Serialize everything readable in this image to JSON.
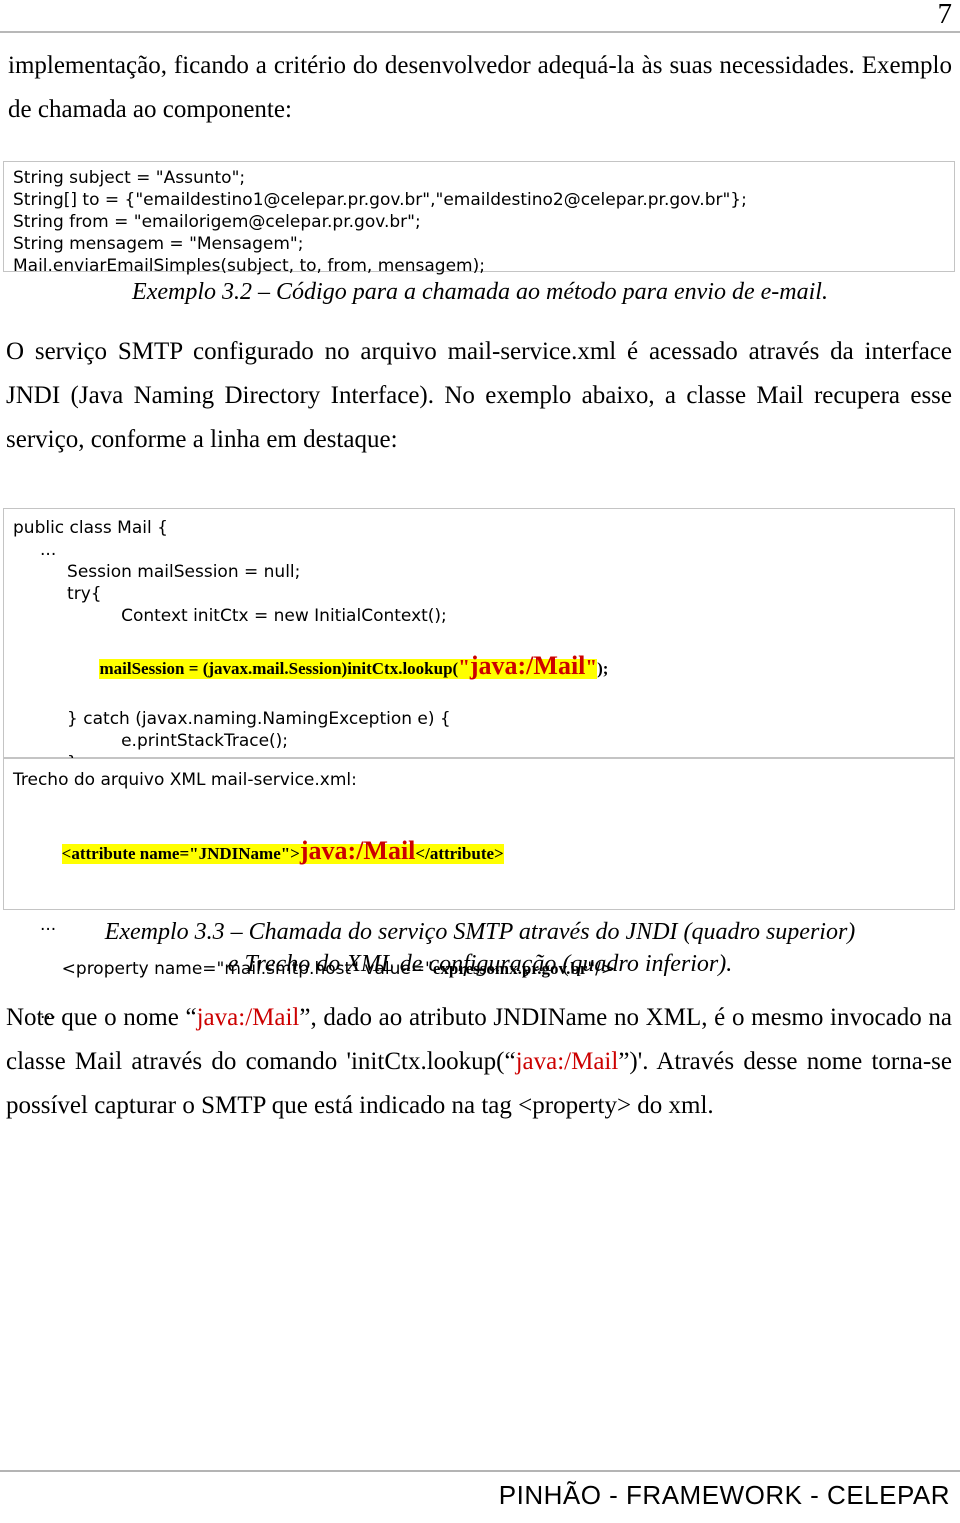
{
  "page": {
    "number": "7",
    "footer": "PINHÃO - FRAMEWORK - CELEPAR",
    "accent_red": "#cc0000",
    "highlight_yellow": "#ffff00",
    "rule_gray": "#b8b8b8"
  },
  "paragraphs": {
    "intro": "implementação, ficando a critério do desenvolvedor adequá-la às suas necessidades. Exemplo de chamada ao componente:",
    "smtp": "O serviço SMTP configurado no arquivo mail-service.xml é acessado através da interface JNDI (Java Naming Directory Interface). No exemplo abaixo, a classe Mail recupera esse serviço, conforme a linha em destaque:",
    "note_part1": "Note que o nome “",
    "note_red1": "java:/Mail",
    "note_part2": "”, dado ao atributo JNDIName no XML, é o mesmo invocado na classe Mail através do comando 'initCtx.lookup(“",
    "note_red2": "java:/Mail",
    "note_part3": "”)'. Através desse nome torna-se possível capturar o SMTP que está indicado na tag <property> do xml."
  },
  "code_block_1": {
    "lines": [
      "String subject = \"Assunto\";",
      "String[] to = {\"emaildestino1@celepar.pr.gov.br\",\"emaildestino2@celepar.pr.gov.br\"};",
      "String from = \"emailorigem@celepar.pr.gov.br\";",
      "String mensagem = \"Mensagem\";",
      "Mail.enviarEmailSimples(subject, to, from, mensagem);"
    ]
  },
  "caption_32": "Exemplo 3.2 – Código para a chamada ao método para envio de e-mail.",
  "code_block_2": {
    "line_01": "public class Mail {",
    "line_02": "     ...",
    "line_03": "          Session mailSession = null;",
    "line_04": "          try{",
    "line_05": "                    Context initCtx = new InitialContext();",
    "line_06_pre": "mailSession = (javax.mail.Session)initCtx.lookup(",
    "line_06_quote_open": "\"",
    "line_06_red": "java:/Mail",
    "line_06_quote_close": "\"",
    "line_06_post": ");",
    "line_07": "          } catch (javax.naming.NamingException e) {",
    "line_08": "                    e.printStackTrace();",
    "line_09": "          }",
    "line_10": "     ...",
    "line_11": "}"
  },
  "xml_block": {
    "heading": "Trecho do arquivo XML mail-service.xml:",
    "attr_pre": "<attribute name=\"JNDIName\">",
    "attr_red": "java:/Mail",
    "attr_post": "</attribute>",
    "ellipsis_1": "...",
    "property_pre": "<property name=\"mail.smtp.host\" value=\"",
    "property_bold": "expressomx.pr.gov.br",
    "property_post": "\"/>",
    "ellipsis_2": "..."
  },
  "caption_33": {
    "line1": "Exemplo 3.3 – Chamada do serviço SMTP através do JNDI (quadro superior)",
    "line2": "e Trecho do XML de configuração (quadro inferior)."
  }
}
